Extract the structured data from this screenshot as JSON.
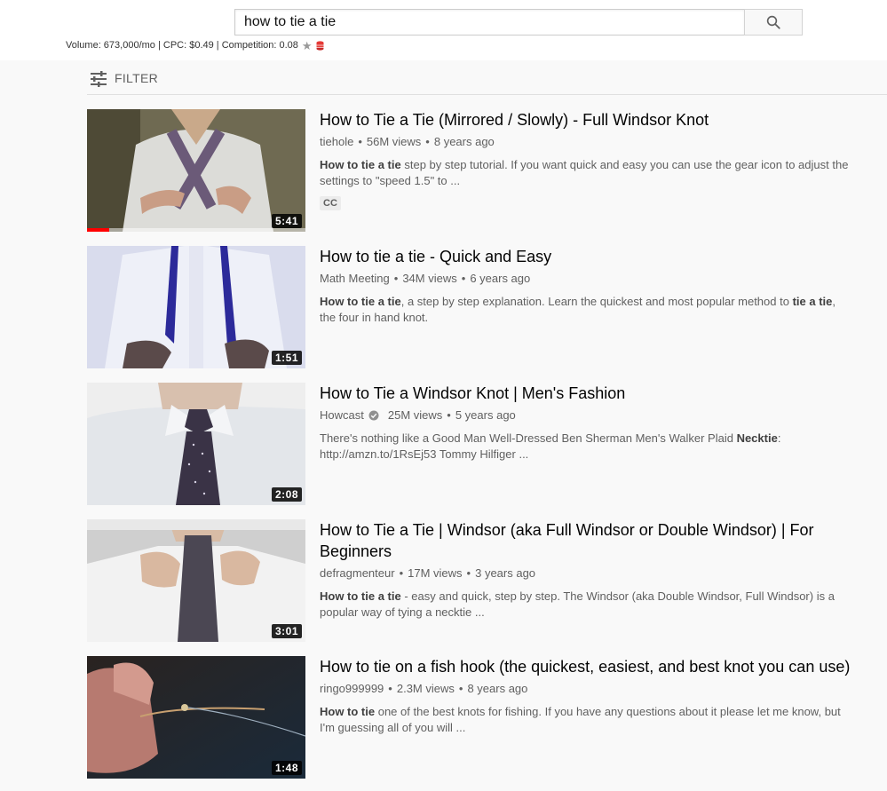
{
  "search": {
    "query": "how to tie a tie",
    "button_icon": "search-icon"
  },
  "seo": {
    "volume": "Volume: 673,000/mo | CPC: $0.49 | Competition: 0.08"
  },
  "filter": {
    "label": "FILTER",
    "icon": "tune-icon"
  },
  "results": [
    {
      "title": "How to Tie a Tie (Mirrored / Slowly) - Full Windsor Knot",
      "channel": "tiehole",
      "views": "56M views",
      "age": "8 years ago",
      "desc_parts": [
        {
          "t": "How to tie a tie",
          "b": true
        },
        {
          "t": " step by step tutorial. If you want quick and easy you can use the gear icon to adjust the settings to \"speed 1.5\" to ...",
          "b": false
        }
      ],
      "badge": "CC",
      "duration": "5:41",
      "watched_fraction": 0.1
    },
    {
      "title": "How to tie a tie - Quick and Easy",
      "channel": "Math Meeting",
      "views": "34M views",
      "age": "6 years ago",
      "desc_parts": [
        {
          "t": "How to tie a tie",
          "b": true
        },
        {
          "t": ", a step by step explanation. Learn the quickest and most popular method to ",
          "b": false
        },
        {
          "t": "tie a tie",
          "b": true
        },
        {
          "t": ", the four in hand knot.",
          "b": false
        }
      ],
      "duration": "1:51"
    },
    {
      "title": "How to Tie a Windsor Knot | Men's Fashion",
      "channel": "Howcast",
      "verified": true,
      "views": "25M views",
      "age": "5 years ago",
      "desc_parts": [
        {
          "t": "There's nothing like a Good Man Well-Dressed Ben Sherman Men's Walker Plaid ",
          "b": false
        },
        {
          "t": "Necktie",
          "b": true
        },
        {
          "t": ": http://amzn.to/1RsEj53 Tommy Hilfiger ...",
          "b": false
        }
      ],
      "duration": "2:08"
    },
    {
      "title": "How to Tie a Tie | Windsor (aka Full Windsor or Double Windsor) | For Beginners",
      "channel": "defragmenteur",
      "views": "17M views",
      "age": "3 years ago",
      "desc_parts": [
        {
          "t": "How to tie a tie",
          "b": true
        },
        {
          "t": " - easy and quick, step by step. The Windsor (aka Double Windsor, Full Windsor) is a popular way of tying a necktie ...",
          "b": false
        }
      ],
      "duration": "3:01"
    },
    {
      "title": "How to tie on a fish hook (the quickest, easiest, and best knot you can use)",
      "channel": "ringo999999",
      "views": "2.3M views",
      "age": "8 years ago",
      "desc_parts": [
        {
          "t": "How to tie",
          "b": true
        },
        {
          "t": " one of the best knots for fishing. If you have any questions about it please let me know, but I'm guessing all of you will ...",
          "b": false
        }
      ],
      "duration": "1:48"
    }
  ]
}
